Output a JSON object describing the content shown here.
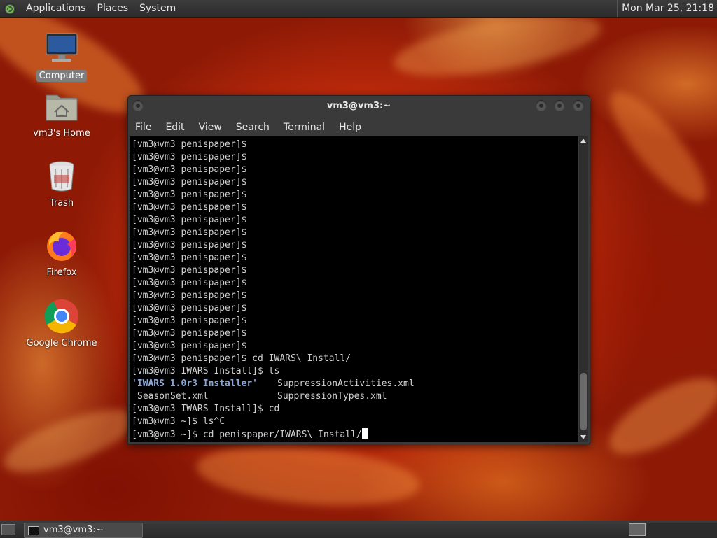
{
  "top_panel": {
    "menus": [
      "Applications",
      "Places",
      "System"
    ],
    "clock": "Mon Mar 25, 21:18"
  },
  "desktop_icons": [
    {
      "label": "Computer",
      "icon": "computer-icon",
      "selected": true
    },
    {
      "label": "vm3's Home",
      "icon": "home-folder-icon"
    },
    {
      "label": "Trash",
      "icon": "trash-icon"
    },
    {
      "label": "Firefox",
      "icon": "firefox-icon"
    },
    {
      "label": "Google Chrome",
      "icon": "chrome-icon"
    }
  ],
  "terminal": {
    "title": "vm3@vm3:~",
    "menus": [
      "File",
      "Edit",
      "View",
      "Search",
      "Terminal",
      "Help"
    ],
    "lines": [
      "[vm3@vm3 penispaper]$",
      "[vm3@vm3 penispaper]$",
      "[vm3@vm3 penispaper]$",
      "[vm3@vm3 penispaper]$",
      "[vm3@vm3 penispaper]$",
      "[vm3@vm3 penispaper]$",
      "[vm3@vm3 penispaper]$",
      "[vm3@vm3 penispaper]$",
      "[vm3@vm3 penispaper]$",
      "[vm3@vm3 penispaper]$",
      "[vm3@vm3 penispaper]$",
      "[vm3@vm3 penispaper]$",
      "[vm3@vm3 penispaper]$",
      "[vm3@vm3 penispaper]$",
      "[vm3@vm3 penispaper]$",
      "[vm3@vm3 penispaper]$",
      "[vm3@vm3 penispaper]$",
      "[vm3@vm3 penispaper]$ cd IWARS\\ Install/",
      "[vm3@vm3 IWARS Install]$ ls"
    ],
    "ls_output": {
      "dir": "'IWARS 1.0r3 Installer'",
      "col2_row1": "SuppressionActivities.xml",
      "col1_row2": "SeasonSet.xml",
      "col2_row2": "SuppressionTypes.xml"
    },
    "tail_lines": [
      "[vm3@vm3 IWARS Install]$ cd",
      "[vm3@vm3 ~]$ ls^C"
    ],
    "current_line": "[vm3@vm3 ~]$ cd penispaper/IWARS\\ Install/"
  },
  "taskbar": {
    "task_label": "vm3@vm3:~"
  },
  "colors": {
    "panel": "#2f2f2f",
    "terminal_bg": "#000000",
    "terminal_fg": "#d0d0d0",
    "dir_color": "#8aa7d6",
    "wallpaper_primary": "#c93a0c"
  }
}
